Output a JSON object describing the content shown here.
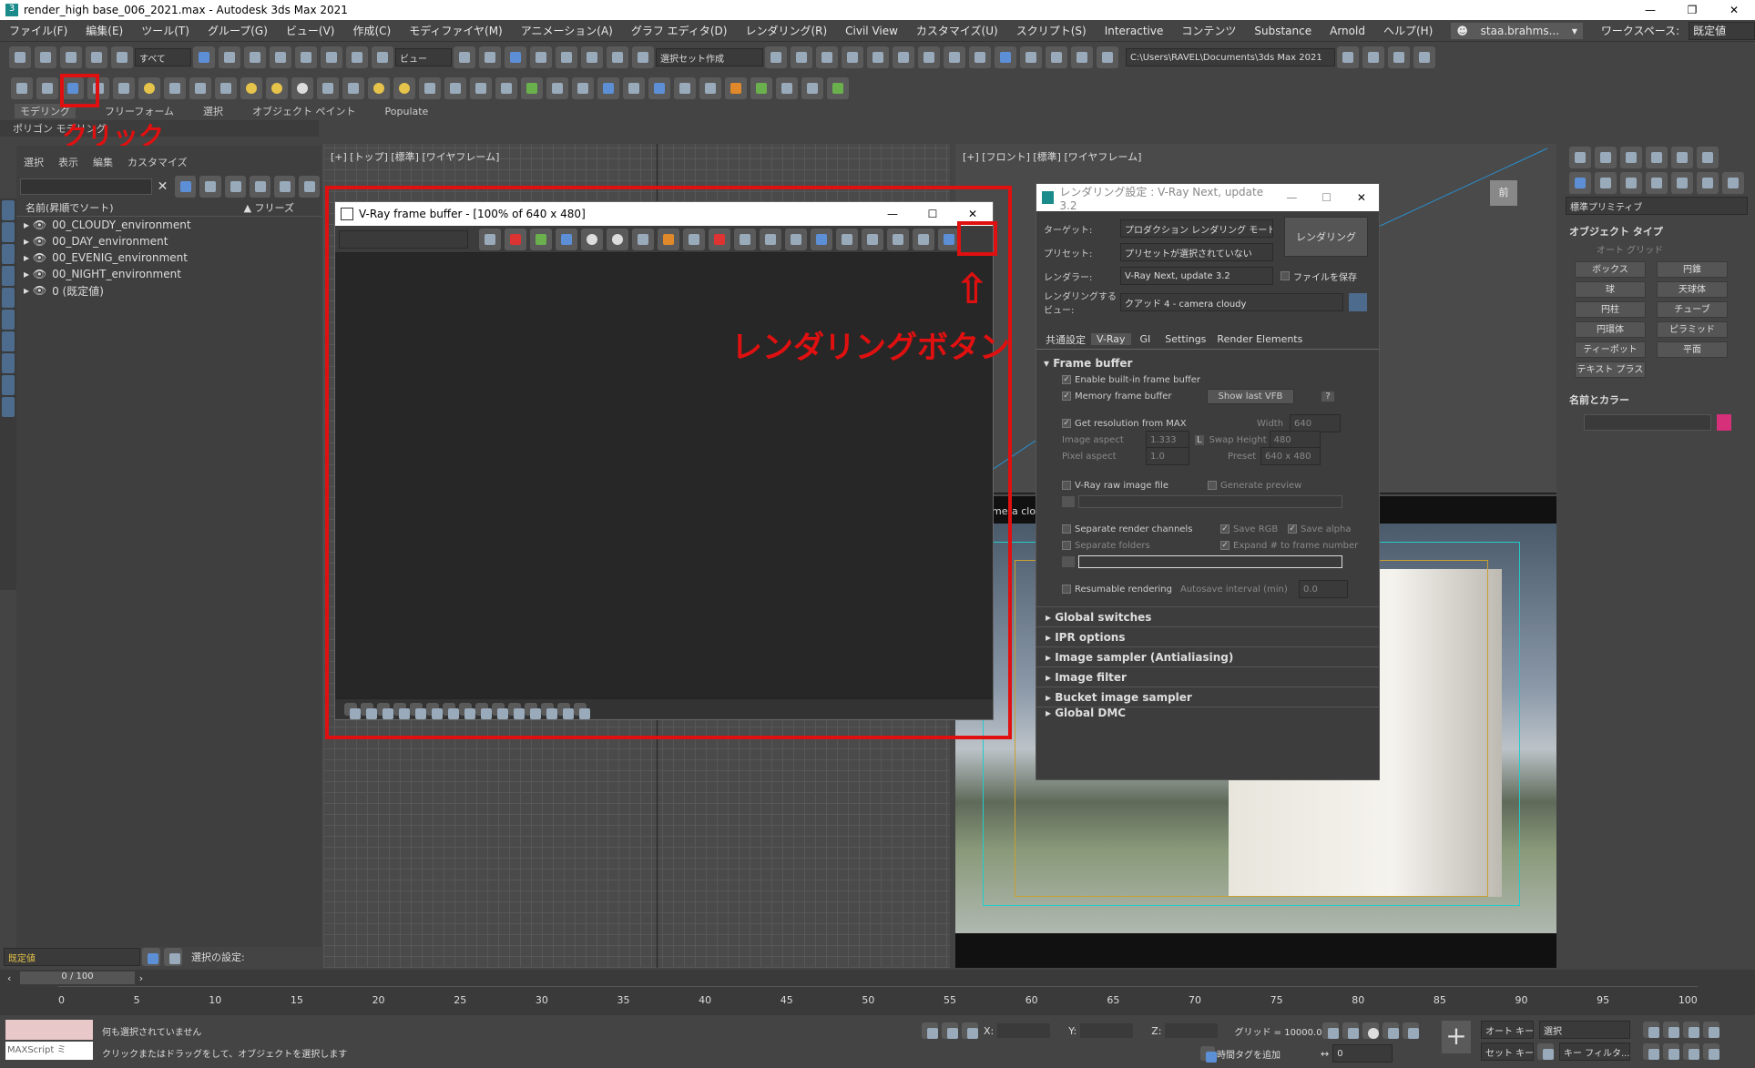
{
  "window": {
    "title": "render_high base_006_2021.max - Autodesk 3ds Max 2021",
    "min": "—",
    "max": "❐",
    "close": "✕"
  },
  "menu": [
    "ファイル(F)",
    "編集(E)",
    "ツール(T)",
    "グループ(G)",
    "ビュー(V)",
    "作成(C)",
    "モディファイヤ(M)",
    "アニメーション(A)",
    "グラフ エディタ(D)",
    "レンダリング(R)",
    "Civil View",
    "カスタマイズ(U)",
    "スクリプト(S)",
    "Interactive",
    "コンテンツ",
    "Substance",
    "Arnold",
    "ヘルプ(H)"
  ],
  "user": "staa.brahms...",
  "workspace_label": "ワークスペース:",
  "workspace_value": "既定値",
  "toolbar": {
    "filter": "すべて",
    "refcoord": "ビュー",
    "selset": "選択セット作成",
    "path": "C:\\Users\\RAVEL\\Documents\\3ds Max 2021"
  },
  "ribbon_tabs": [
    "モデリング",
    "フリーフォーム",
    "選択",
    "オブジェクト ペイント",
    "Populate"
  ],
  "ribbon_sub": "ポリゴン モデリング",
  "annotations": {
    "click": "クリック",
    "render_button": "レンダリングボタン",
    "arrow": "⇧"
  },
  "scene": {
    "tabs": [
      "選択",
      "表示",
      "編集",
      "カスタマイズ"
    ],
    "col_name": "名前(昇順でソート)",
    "col_freeze": "▲ フリーズ",
    "items": [
      "00_CLOUDY_environment",
      "00_DAY_environment",
      "00_EVENIG_environment",
      "00_NIGHT_environment",
      "0 (既定値)"
    ]
  },
  "viewports": {
    "top": "[+] [トップ] [標準] [ワイヤフレーム]",
    "front": "[+] [フロント] [標準] [ワイヤフレーム]",
    "front_badge": "前",
    "persp_label": "mera clo"
  },
  "vfb": {
    "title": "V-Ray frame buffer - [100% of 640 x 480]"
  },
  "render_setup": {
    "title": "レンダリング設定 : V-Ray Next, update 3.2",
    "target_label": "ターゲット:",
    "target": "プロダクション レンダリング モード",
    "preset_label": "プリセット:",
    "preset": "プリセットが選択されていない",
    "renderer_label": "レンダラー:",
    "renderer": "V-Ray Next, update 3.2",
    "save_file": "ファイルを保存",
    "view_label": "レンダリングするビュー:",
    "view": "クアッド 4 - camera cloudy",
    "render_btn": "レンダリング",
    "tabs": [
      "共通設定",
      "V-Ray",
      "GI",
      "Settings",
      "Render Elements"
    ],
    "fb": {
      "header": "Frame buffer",
      "enable": "Enable built-in frame buffer",
      "memory": "Memory frame buffer",
      "show_last": "Show last VFB",
      "help": "?",
      "get_res": "Get resolution from MAX",
      "width_label": "Width",
      "width": "640",
      "height_label": "Height",
      "height": "480",
      "aspect_label": "Image aspect",
      "aspect": "1.333",
      "lock": "L",
      "swap": "Swap",
      "pixel_label": "Pixel aspect",
      "pixel": "1.0",
      "preset_label": "Preset",
      "preset": "640 x 480",
      "raw": "V-Ray raw image file",
      "gen_preview": "Generate preview",
      "sep": "Separate render channels",
      "save_rgb": "Save RGB",
      "save_alpha": "Save alpha",
      "sep_folders": "Separate folders",
      "expand": "Expand # to frame number",
      "resumable": "Resumable rendering",
      "autosave_label": "Autosave interval (min)",
      "autosave": "0.0"
    },
    "rollouts": [
      "Global switches",
      "IPR options",
      "Image sampler (Antialiasing)",
      "Image filter",
      "Bucket image sampler",
      "Global DMC"
    ]
  },
  "cmd": {
    "dropdown": "標準プリミティブ",
    "section1": "オブジェクト タイプ",
    "autogrid": "オート グリッド",
    "buttons": [
      "ボックス",
      "円錐",
      "球",
      "天球体",
      "円柱",
      "チューブ",
      "円環体",
      "ピラミッド",
      "ティーポット",
      "平面",
      "テキスト プラス"
    ],
    "section2": "名前とカラー",
    "color": "#d6307a"
  },
  "timeline": {
    "frame": "0 / 100",
    "ticks": [
      "0",
      "5",
      "10",
      "15",
      "20",
      "25",
      "30",
      "35",
      "40",
      "45",
      "50",
      "55",
      "60",
      "65",
      "70",
      "75",
      "80",
      "85",
      "90",
      "95",
      "100"
    ]
  },
  "status": {
    "layer": "既定値",
    "sel_label": "選択の設定:",
    "script": "MAXScript ミ",
    "msg1": "何も選択されていません",
    "msg2": "クリックまたはドラッグをして、オブジェクトを選択します",
    "x": "X:",
    "y": "Y:",
    "z": "Z:",
    "grid": "グリッド = 10000.0",
    "addtag": "時間タグを追加",
    "autokey": "オート キー",
    "setkey": "セット キー",
    "sel": "選択",
    "keyfilter": "キー フィルタ...",
    "frame": "0"
  }
}
